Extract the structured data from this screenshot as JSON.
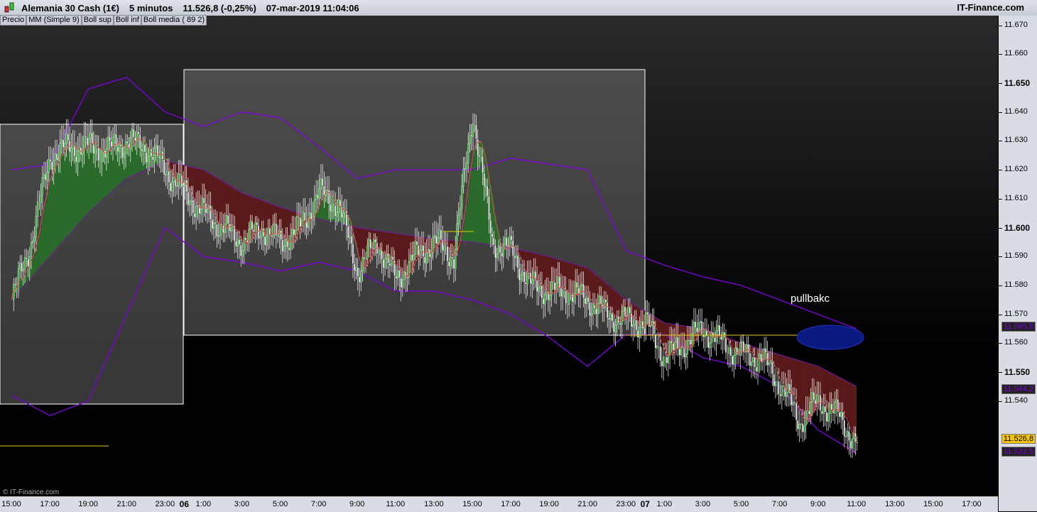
{
  "header": {
    "instrument": "Alemania 30 Cash (1€)",
    "timeframe": "5 minutos",
    "price": "11.526,8 (-0,25%)",
    "datetime": "07-mar-2019 11:04:06",
    "brand": "IT-Finance.com"
  },
  "legend": [
    "Precio",
    "MM (Simple 9)",
    "Boll sup",
    "Boll inf",
    "Boll media ( 89 2)"
  ],
  "legend_colors": [
    "#888888",
    "#e05050",
    "#8000e0",
    "#8000e0",
    "#8000e0"
  ],
  "annotation": "pullbakc",
  "copyright": "© IT-Finance.com",
  "price_tags": [
    {
      "text": "11.565,8",
      "price": 11565.8,
      "color": "#8000e0"
    },
    {
      "text": "11.544,2",
      "price": 11544.2,
      "color": "#8000e0"
    },
    {
      "text": "11.527,0",
      "price": 11527.0,
      "color": "#e05050"
    },
    {
      "text": "11.526,8",
      "price": 11526.8,
      "color": "#000000",
      "bg": "#f5c400"
    },
    {
      "text": "11.522,5",
      "price": 11522.5,
      "color": "#8000e0"
    }
  ],
  "chart_data": {
    "type": "candlestick",
    "title": "Alemania 30 Cash (1€) 5 minutos",
    "ylim": [
      11516,
      11674
    ],
    "yticks": [
      {
        "v": 11670,
        "t": "11.670"
      },
      {
        "v": 11660,
        "t": "11.660"
      },
      {
        "v": 11650,
        "t": "11.650",
        "b": true
      },
      {
        "v": 11640,
        "t": "11.640"
      },
      {
        "v": 11630,
        "t": "11.630"
      },
      {
        "v": 11620,
        "t": "11.620"
      },
      {
        "v": 11610,
        "t": "11.610"
      },
      {
        "v": 11600,
        "t": "11.600",
        "b": true
      },
      {
        "v": 11590,
        "t": "11.590"
      },
      {
        "v": 11580,
        "t": "11.580"
      },
      {
        "v": 11570,
        "t": "11.570"
      },
      {
        "v": 11560,
        "t": "11.560"
      },
      {
        "v": 11550,
        "t": "11.550",
        "b": true
      },
      {
        "v": 11540,
        "t": "11.540"
      }
    ],
    "xticks": [
      {
        "h": 0,
        "t": "15:00"
      },
      {
        "h": 2,
        "t": "17:00"
      },
      {
        "h": 4,
        "t": "19:00"
      },
      {
        "h": 6,
        "t": "21:00"
      },
      {
        "h": 8,
        "t": "23:00"
      },
      {
        "h": 9,
        "t": "06",
        "b": true
      },
      {
        "h": 10,
        "t": "1:00"
      },
      {
        "h": 12,
        "t": "3:00"
      },
      {
        "h": 14,
        "t": "5:00"
      },
      {
        "h": 16,
        "t": "7:00"
      },
      {
        "h": 18,
        "t": "9:00"
      },
      {
        "h": 20,
        "t": "11:00"
      },
      {
        "h": 22,
        "t": "13:00"
      },
      {
        "h": 24,
        "t": "15:00"
      },
      {
        "h": 26,
        "t": "17:00"
      },
      {
        "h": 28,
        "t": "19:00"
      },
      {
        "h": 30,
        "t": "21:00"
      },
      {
        "h": 32,
        "t": "23:00"
      },
      {
        "h": 33,
        "t": "07",
        "b": true
      },
      {
        "h": 34,
        "t": "1:00"
      },
      {
        "h": 36,
        "t": "3:00"
      },
      {
        "h": 38,
        "t": "5:00"
      },
      {
        "h": 40,
        "t": "7:00"
      },
      {
        "h": 42,
        "t": "9:00"
      },
      {
        "h": 44,
        "t": "11:00"
      },
      {
        "h": 46,
        "t": "13:00"
      },
      {
        "h": 48,
        "t": "15:00"
      },
      {
        "h": 50,
        "t": "17:00"
      }
    ],
    "price_hourly": [
      11575,
      11595,
      11625,
      11628,
      11628,
      11627,
      11630,
      11628,
      11620,
      11612,
      11605,
      11600,
      11595,
      11600,
      11595,
      11600,
      11612,
      11608,
      11585,
      11595,
      11582,
      11590,
      11595,
      11590,
      11640,
      11595,
      11592,
      11580,
      11578,
      11578,
      11575,
      11570,
      11568,
      11567,
      11555,
      11560,
      11565,
      11560,
      11556,
      11555,
      11546,
      11533,
      11540,
      11535,
      11525
    ],
    "boll_media_2h": [
      11575,
      11590,
      11605,
      11617,
      11623,
      11620,
      11612,
      11607,
      11603,
      11600,
      11598,
      11596,
      11595,
      11593,
      11590,
      11586,
      11575,
      11567,
      11565,
      11560,
      11556,
      11552,
      11545
    ],
    "boll_sup_2h": [
      11620,
      11622,
      11648,
      11652,
      11640,
      11635,
      11640,
      11638,
      11628,
      11617,
      11620,
      11620,
      11620,
      11624,
      11622,
      11620,
      11592,
      11587,
      11583,
      11580,
      11575,
      11570,
      11565
    ],
    "boll_inf_2h": [
      11542,
      11535,
      11540,
      11570,
      11600,
      11590,
      11588,
      11585,
      11588,
      11585,
      11578,
      11578,
      11575,
      11570,
      11562,
      11552,
      11563,
      11563,
      11555,
      11552,
      11545,
      11530,
      11522
    ]
  }
}
